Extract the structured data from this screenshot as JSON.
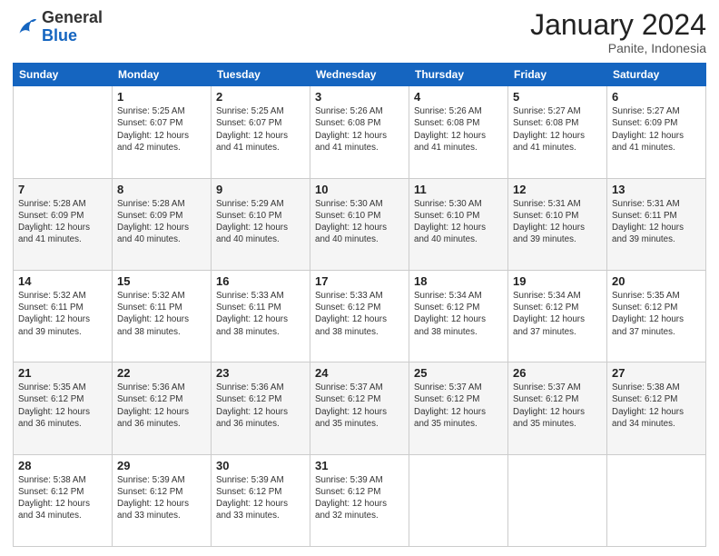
{
  "header": {
    "logo_line1": "General",
    "logo_line2": "Blue",
    "month": "January 2024",
    "location": "Panite, Indonesia"
  },
  "weekdays": [
    "Sunday",
    "Monday",
    "Tuesday",
    "Wednesday",
    "Thursday",
    "Friday",
    "Saturday"
  ],
  "weeks": [
    [
      {
        "day": "",
        "info": ""
      },
      {
        "day": "1",
        "info": "Sunrise: 5:25 AM\nSunset: 6:07 PM\nDaylight: 12 hours\nand 42 minutes."
      },
      {
        "day": "2",
        "info": "Sunrise: 5:25 AM\nSunset: 6:07 PM\nDaylight: 12 hours\nand 41 minutes."
      },
      {
        "day": "3",
        "info": "Sunrise: 5:26 AM\nSunset: 6:08 PM\nDaylight: 12 hours\nand 41 minutes."
      },
      {
        "day": "4",
        "info": "Sunrise: 5:26 AM\nSunset: 6:08 PM\nDaylight: 12 hours\nand 41 minutes."
      },
      {
        "day": "5",
        "info": "Sunrise: 5:27 AM\nSunset: 6:08 PM\nDaylight: 12 hours\nand 41 minutes."
      },
      {
        "day": "6",
        "info": "Sunrise: 5:27 AM\nSunset: 6:09 PM\nDaylight: 12 hours\nand 41 minutes."
      }
    ],
    [
      {
        "day": "7",
        "info": "Sunrise: 5:28 AM\nSunset: 6:09 PM\nDaylight: 12 hours\nand 41 minutes."
      },
      {
        "day": "8",
        "info": "Sunrise: 5:28 AM\nSunset: 6:09 PM\nDaylight: 12 hours\nand 40 minutes."
      },
      {
        "day": "9",
        "info": "Sunrise: 5:29 AM\nSunset: 6:10 PM\nDaylight: 12 hours\nand 40 minutes."
      },
      {
        "day": "10",
        "info": "Sunrise: 5:30 AM\nSunset: 6:10 PM\nDaylight: 12 hours\nand 40 minutes."
      },
      {
        "day": "11",
        "info": "Sunrise: 5:30 AM\nSunset: 6:10 PM\nDaylight: 12 hours\nand 40 minutes."
      },
      {
        "day": "12",
        "info": "Sunrise: 5:31 AM\nSunset: 6:10 PM\nDaylight: 12 hours\nand 39 minutes."
      },
      {
        "day": "13",
        "info": "Sunrise: 5:31 AM\nSunset: 6:11 PM\nDaylight: 12 hours\nand 39 minutes."
      }
    ],
    [
      {
        "day": "14",
        "info": "Sunrise: 5:32 AM\nSunset: 6:11 PM\nDaylight: 12 hours\nand 39 minutes."
      },
      {
        "day": "15",
        "info": "Sunrise: 5:32 AM\nSunset: 6:11 PM\nDaylight: 12 hours\nand 38 minutes."
      },
      {
        "day": "16",
        "info": "Sunrise: 5:33 AM\nSunset: 6:11 PM\nDaylight: 12 hours\nand 38 minutes."
      },
      {
        "day": "17",
        "info": "Sunrise: 5:33 AM\nSunset: 6:12 PM\nDaylight: 12 hours\nand 38 minutes."
      },
      {
        "day": "18",
        "info": "Sunrise: 5:34 AM\nSunset: 6:12 PM\nDaylight: 12 hours\nand 38 minutes."
      },
      {
        "day": "19",
        "info": "Sunrise: 5:34 AM\nSunset: 6:12 PM\nDaylight: 12 hours\nand 37 minutes."
      },
      {
        "day": "20",
        "info": "Sunrise: 5:35 AM\nSunset: 6:12 PM\nDaylight: 12 hours\nand 37 minutes."
      }
    ],
    [
      {
        "day": "21",
        "info": "Sunrise: 5:35 AM\nSunset: 6:12 PM\nDaylight: 12 hours\nand 36 minutes."
      },
      {
        "day": "22",
        "info": "Sunrise: 5:36 AM\nSunset: 6:12 PM\nDaylight: 12 hours\nand 36 minutes."
      },
      {
        "day": "23",
        "info": "Sunrise: 5:36 AM\nSunset: 6:12 PM\nDaylight: 12 hours\nand 36 minutes."
      },
      {
        "day": "24",
        "info": "Sunrise: 5:37 AM\nSunset: 6:12 PM\nDaylight: 12 hours\nand 35 minutes."
      },
      {
        "day": "25",
        "info": "Sunrise: 5:37 AM\nSunset: 6:12 PM\nDaylight: 12 hours\nand 35 minutes."
      },
      {
        "day": "26",
        "info": "Sunrise: 5:37 AM\nSunset: 6:12 PM\nDaylight: 12 hours\nand 35 minutes."
      },
      {
        "day": "27",
        "info": "Sunrise: 5:38 AM\nSunset: 6:12 PM\nDaylight: 12 hours\nand 34 minutes."
      }
    ],
    [
      {
        "day": "28",
        "info": "Sunrise: 5:38 AM\nSunset: 6:12 PM\nDaylight: 12 hours\nand 34 minutes."
      },
      {
        "day": "29",
        "info": "Sunrise: 5:39 AM\nSunset: 6:12 PM\nDaylight: 12 hours\nand 33 minutes."
      },
      {
        "day": "30",
        "info": "Sunrise: 5:39 AM\nSunset: 6:12 PM\nDaylight: 12 hours\nand 33 minutes."
      },
      {
        "day": "31",
        "info": "Sunrise: 5:39 AM\nSunset: 6:12 PM\nDaylight: 12 hours\nand 32 minutes."
      },
      {
        "day": "",
        "info": ""
      },
      {
        "day": "",
        "info": ""
      },
      {
        "day": "",
        "info": ""
      }
    ]
  ]
}
